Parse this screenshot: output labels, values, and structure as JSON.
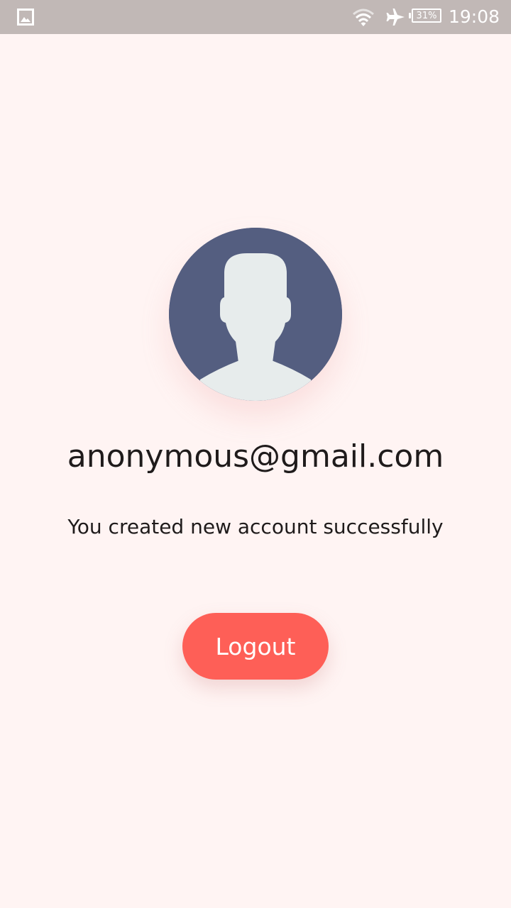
{
  "status_bar": {
    "battery_percent": "31%",
    "time": "19:08",
    "icons": [
      "image-notification-icon",
      "wifi-icon",
      "airplane-mode-icon",
      "battery-icon"
    ]
  },
  "profile": {
    "avatar_icon": "default-user-avatar-icon",
    "email": "anonymous@gmail.com",
    "message": "You created new account successfully"
  },
  "actions": {
    "logout_label": "Logout"
  },
  "colors": {
    "background": "#fff4f3",
    "status_bar": "#c1b8b6",
    "avatar_bg": "#545e80",
    "avatar_silhouette": "#e7ecec",
    "button": "#fe5f57"
  }
}
